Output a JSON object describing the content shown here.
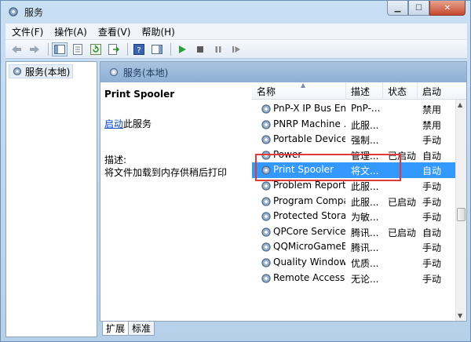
{
  "window": {
    "title": "服务"
  },
  "menu": [
    "文件(F)",
    "操作(A)",
    "查看(V)",
    "帮助(H)"
  ],
  "left_tree": {
    "root_label": "服务(本地)"
  },
  "right_header": {
    "label": "服务(本地)"
  },
  "extended": {
    "service_name": "Print Spooler",
    "start_link": "启动",
    "start_suffix": "此服务",
    "desc_label": "描述:",
    "desc_text": "将文件加载到内存供稍后打印"
  },
  "columns": {
    "name": "名称",
    "desc": "描述",
    "status": "状态",
    "startup": "启动"
  },
  "services": [
    {
      "name": "PnP-X IP Bus En...",
      "desc": "PnP-...",
      "status": "",
      "startup": "禁用"
    },
    {
      "name": "PNRP Machine ...",
      "desc": "此服...",
      "status": "",
      "startup": "禁用"
    },
    {
      "name": "Portable Device ...",
      "desc": "强制...",
      "status": "",
      "startup": "手动"
    },
    {
      "name": "Power",
      "desc": "管理...",
      "status": "已启动",
      "startup": "自动"
    },
    {
      "name": "Print Spooler",
      "desc": "将文...",
      "status": "",
      "startup": "自动"
    },
    {
      "name": "Problem Report...",
      "desc": "此服...",
      "status": "",
      "startup": "手动"
    },
    {
      "name": "Program Compa...",
      "desc": "此服...",
      "status": "已启动",
      "startup": "手动"
    },
    {
      "name": "Protected Storage",
      "desc": "为敏...",
      "status": "",
      "startup": "手动"
    },
    {
      "name": "QPCore Service",
      "desc": "腾讯...",
      "status": "已启动",
      "startup": "自动"
    },
    {
      "name": "QQMicroGameB...",
      "desc": "腾讯...",
      "status": "",
      "startup": "手动"
    },
    {
      "name": "Quality Windows...",
      "desc": "优质...",
      "status": "",
      "startup": "手动"
    },
    {
      "name": "Remote Access ...",
      "desc": "无论...",
      "status": "",
      "startup": "手动"
    }
  ],
  "selected_index": 4,
  "tabs": [
    "扩展",
    "标准"
  ],
  "colors": {
    "selection": "#3399ff",
    "highlight_box": "#e03b3b",
    "link": "#0645c8"
  }
}
